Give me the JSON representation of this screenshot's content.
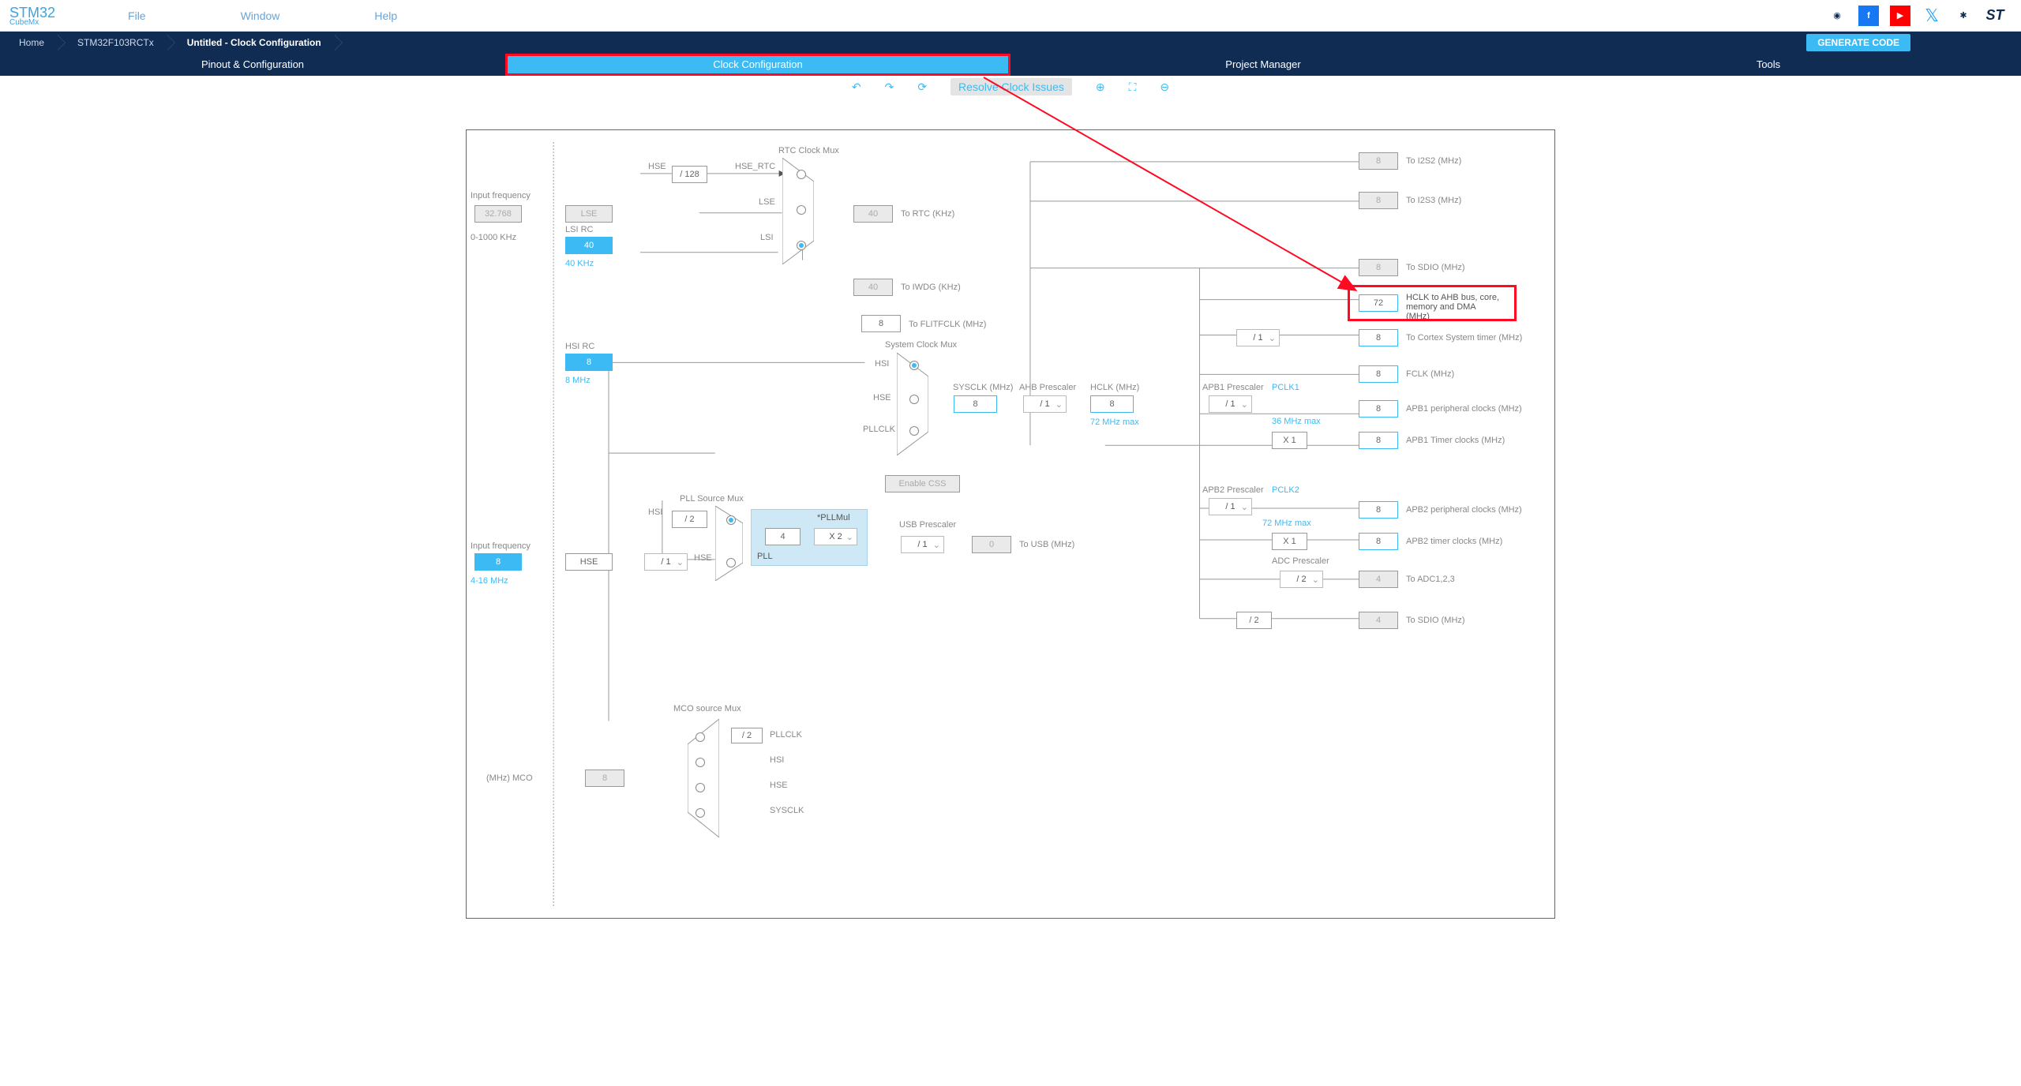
{
  "logo": {
    "line1": "STM32",
    "line2": "CubeMx"
  },
  "menu": {
    "file": "File",
    "window": "Window",
    "help": "Help"
  },
  "gen_code": "GENERATE CODE",
  "bc": {
    "home": "Home",
    "chip": "STM32F103RCTx",
    "page": "Untitled - Clock Configuration"
  },
  "tabs": {
    "pinout": "Pinout & Configuration",
    "clock": "Clock Configuration",
    "project": "Project Manager",
    "tools": "Tools"
  },
  "toolbar": {
    "resolve": "Resolve Clock Issues"
  },
  "labels": {
    "input_freq_lse": "Input frequency",
    "lse_range": "0-1000 KHz",
    "lsi_rc": "LSI RC",
    "lsi_khz": "40 KHz",
    "hsi_rc": "HSI RC",
    "hsi_mhz": "8 MHz",
    "input_freq_hse": "Input frequency",
    "hse_range": "4-16 MHz",
    "rtc_mux": "RTC Clock Mux",
    "hse_rtc": "HSE_RTC",
    "lse": "LSE",
    "lsi": "LSI",
    "to_rtc": "To RTC (KHz)",
    "to_iwdg": "To IWDG (KHz)",
    "sys_mux": "System Clock Mux",
    "hsi": "HSI",
    "hse": "HSE",
    "pllclk": "PLLCLK",
    "sysclk": "SYSCLK (MHz)",
    "ahb_pre": "AHB Prescaler",
    "hclk": "HCLK (MHz)",
    "hclk_max": "72 MHz max",
    "apb1_pre": "APB1 Prescaler",
    "pclk1": "PCLK1",
    "apb1_max": "36 MHz max",
    "apb1_periph": "APB1 peripheral clocks (MHz)",
    "apb1_timer": "APB1 Timer clocks (MHz)",
    "apb2_pre": "APB2 Prescaler",
    "pclk2": "PCLK2",
    "apb2_max": "72 MHz max",
    "apb2_periph": "APB2 peripheral clocks (MHz)",
    "apb2_timer": "APB2 timer clocks (MHz)",
    "adc_pre": "ADC Prescaler",
    "to_adc": "To ADC1,2,3",
    "to_sdio2": "To SDIO (MHz)",
    "fclk": "FCLK (MHz)",
    "cortex": "To Cortex System timer (MHz)",
    "flitfclk": "To FLITFCLK (MHz)",
    "hclk_ahb": "HCLK to AHB bus, core, memory and DMA (MHz)",
    "to_sdio": "To SDIO (MHz)",
    "to_i2s2": "To I2S2 (MHz)",
    "to_i2s3": "To I2S3 (MHz)",
    "pll_src": "PLL Source Mux",
    "pllmul": "*PLLMul",
    "pll": "PLL",
    "usb_pre": "USB Prescaler",
    "to_usb": "To USB (MHz)",
    "enable_css": "Enable CSS",
    "mco_mux": "MCO source Mux",
    "mco_out": "(MHz) MCO",
    "mco_pllclk": "PLLCLK",
    "mco_hsi": "HSI",
    "mco_hse": "HSE",
    "mco_sysclk": "SYSCLK"
  },
  "values": {
    "lse_freq": "32.768",
    "lse_box": "LSE",
    "lsi_val": "40",
    "hsi_val": "8",
    "hse_val": "8",
    "hse_box": "HSE",
    "d128": "/ 128",
    "rtc": "40",
    "iwdg": "40",
    "flitfclk": "8",
    "sysclk": "8",
    "ahb_div": "/ 1",
    "hclk": "8",
    "cortex_div": "/ 1",
    "hclk_ahb": "72",
    "cortex": "8",
    "fclk": "8",
    "i2s2": "8",
    "i2s3": "8",
    "sdio": "8",
    "apb1_div": "/ 1",
    "apb1_x1": "X 1",
    "apb1_p": "8",
    "apb1_t": "8",
    "apb2_div": "/ 1",
    "apb2_x1": "X 1",
    "apb2_p": "8",
    "apb2_t": "8",
    "adc_div": "/ 2",
    "adc": "4",
    "sdio2_div": "/ 2",
    "sdio2": "4",
    "pll_d2": "/ 2",
    "pll_hse_div": "/ 1",
    "pll_in": "4",
    "pllmul": "X 2",
    "usb_div": "/ 1",
    "usb": "0",
    "mco_d2": "/ 2",
    "mco": "8"
  }
}
